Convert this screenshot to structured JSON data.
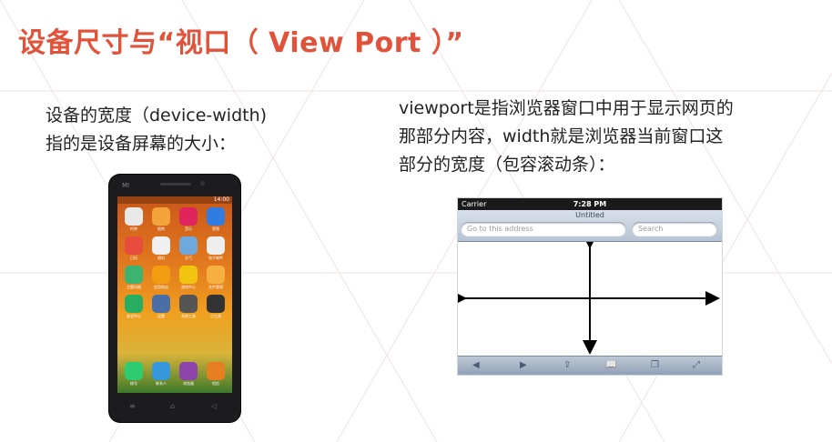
{
  "slide": {
    "title": "设备尺寸与“视口（ View Port ）”",
    "left_text": [
      "设备的宽度（device-width)",
      "指的是设备屏幕的大小："
    ],
    "right_text": [
      "viewport是指浏览器窗口中用于显示网页的",
      "那部分内容，width就是浏览器当前窗口这",
      "部分的宽度（包容滚动条）："
    ]
  },
  "phone": {
    "logo": "MI",
    "status_time": "14:00",
    "apps": [
      {
        "label": "时钟",
        "color": "#e8e8e8"
      },
      {
        "label": "图库",
        "color": "#f2a33a"
      },
      {
        "label": "音乐",
        "color": "#e0245e"
      },
      {
        "label": "视频",
        "color": "#2f7de1"
      },
      {
        "label": "日历",
        "color": "#e74c3c"
      },
      {
        "label": "相机",
        "color": "#f0f0f0"
      },
      {
        "label": "天气",
        "color": "#6fa8dc"
      },
      {
        "label": "电子邮件",
        "color": "#eeeeee"
      },
      {
        "label": "主题风格",
        "color": "#3cb371"
      },
      {
        "label": "应用商店",
        "color": "#f39c12"
      },
      {
        "label": "游戏中心",
        "color": "#f1c40f"
      },
      {
        "label": "文件管理",
        "color": "#f5b041"
      },
      {
        "label": "安全中心",
        "color": "#27ae60"
      },
      {
        "label": "设置",
        "color": "#4a6fa5"
      },
      {
        "label": "系统工具",
        "color": "#555555"
      },
      {
        "label": "小工具",
        "color": "#333333"
      }
    ],
    "dock": [
      {
        "label": "拨号",
        "color": "#2ecc71"
      },
      {
        "label": "联系人",
        "color": "#3498db"
      },
      {
        "label": "浏览器",
        "color": "#8e44ad"
      },
      {
        "label": "短信",
        "color": "#e67e22"
      }
    ],
    "nav": [
      "≡",
      "⌂",
      "◁"
    ]
  },
  "browser": {
    "carrier": "Carrier",
    "time": "7:28 PM",
    "page_title": "Untitled",
    "address_placeholder": "Go to this address",
    "search_placeholder": "Search",
    "bottom_icons": [
      "◀",
      "▶",
      "⇪",
      "📖",
      "❐",
      "⤢"
    ]
  },
  "colors": {
    "title": "#e0533a"
  }
}
